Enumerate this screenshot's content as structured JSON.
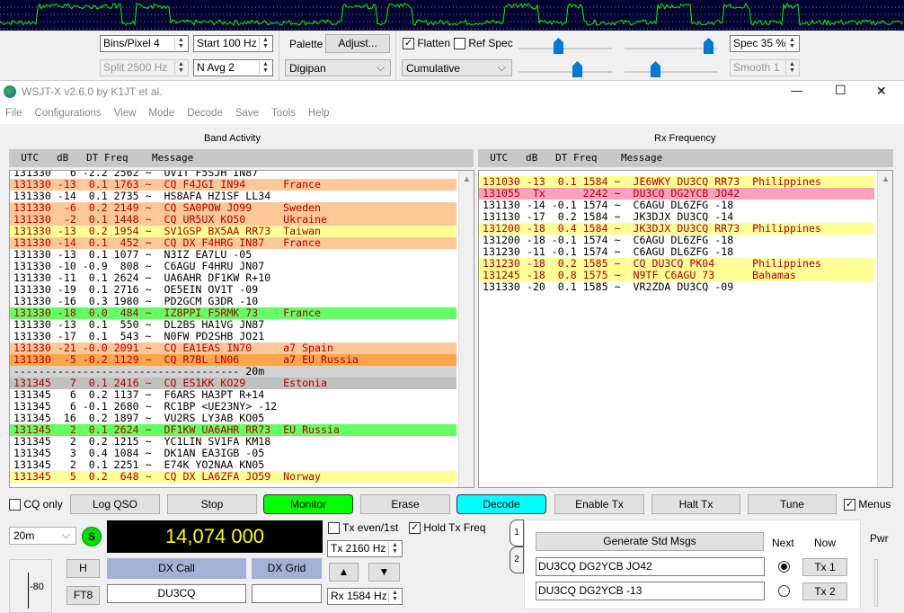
{
  "spectrum": {
    "line_color": "#00ff00",
    "bg": "#000033"
  },
  "controls": {
    "bins_pixel": "Bins/Pixel  4",
    "start": "Start 100 Hz",
    "split": "Split  2500  Hz",
    "navg": "N Avg 2",
    "palette_label": "Palette",
    "adjust": "Adjust...",
    "palette": "Digipan",
    "flatten": "Flatten",
    "flatten_checked": true,
    "refspec": "Ref Spec",
    "refspec_checked": false,
    "cumulative": "Cumulative",
    "spec": "Spec 35 %",
    "smooth": "Smooth  1"
  },
  "window": {
    "title": "WSJT-X   v2.6.0   by K1JT et al.",
    "minimize": "—",
    "maximize": "☐",
    "close": "✕"
  },
  "menu": [
    "File",
    "Configurations",
    "View",
    "Mode",
    "Decode",
    "Save",
    "Tools",
    "Help"
  ],
  "band_activity": {
    "title": "Band Activity",
    "header": "  UTC   dB   DT Freq    Message",
    "rows": [
      {
        "utc": "131330",
        "db": "6",
        "dt": "-2.2",
        "freq": "2562",
        "msg": "OV1T F5SJH IN87",
        "country": "",
        "bg": "#ffffff"
      },
      {
        "utc": "131330",
        "db": "-13",
        "dt": "0.1",
        "freq": "1763",
        "msg": "CQ F4JGI IN94",
        "country": "France",
        "bg": "#ffc896"
      },
      {
        "utc": "131330",
        "db": "-14",
        "dt": "0.1",
        "freq": "2735",
        "msg": "HS8AFA HZ1SF LL34",
        "country": "",
        "bg": "#ffffff"
      },
      {
        "utc": "131330",
        "db": "-6",
        "dt": "0.2",
        "freq": "2149",
        "msg": "CQ SA0POW JO99",
        "country": "Sweden",
        "bg": "#ffc896"
      },
      {
        "utc": "131330",
        "db": "-2",
        "dt": "0.1",
        "freq": "1448",
        "msg": "CQ UR5UX KO50",
        "country": "Ukraine",
        "bg": "#ffc896"
      },
      {
        "utc": "131330",
        "db": "-13",
        "dt": "0.2",
        "freq": "1954",
        "msg": "SV1GSP BX5AA RR73",
        "country": "Taiwan",
        "bg": "#ffff96"
      },
      {
        "utc": "131330",
        "db": "-14",
        "dt": "0.1",
        "freq": "452",
        "msg": "CQ DX F4HRG IN87",
        "country": "France",
        "bg": "#ffc896"
      },
      {
        "utc": "131330",
        "db": "-13",
        "dt": "0.1",
        "freq": "1077",
        "msg": "N3IZ EA7LU -05",
        "country": "",
        "bg": "#ffffff"
      },
      {
        "utc": "131330",
        "db": "-10",
        "dt": "-0.9",
        "freq": "808",
        "msg": "C6AGU F4HRU JN07",
        "country": "",
        "bg": "#ffffff"
      },
      {
        "utc": "131330",
        "db": "-11",
        "dt": "0.1",
        "freq": "2624",
        "msg": "UA6AHR DF1KW R+10",
        "country": "",
        "bg": "#ffffff"
      },
      {
        "utc": "131330",
        "db": "-19",
        "dt": "0.1",
        "freq": "2716",
        "msg": "OE5EIN OV1T -09",
        "country": "",
        "bg": "#ffffff"
      },
      {
        "utc": "131330",
        "db": "-16",
        "dt": "0.3",
        "freq": "1980",
        "msg": "PD2GCM G3DR -10",
        "country": "",
        "bg": "#ffffff"
      },
      {
        "utc": "131330",
        "db": "-18",
        "dt": "0.0",
        "freq": "484",
        "msg": "IZ8PPI F5RMK 73",
        "country": "France",
        "bg": "#64ff64"
      },
      {
        "utc": "131330",
        "db": "-13",
        "dt": "0.1",
        "freq": "550",
        "msg": "DL2BS HA1VG JN87",
        "country": "",
        "bg": "#ffffff"
      },
      {
        "utc": "131330",
        "db": "-17",
        "dt": "0.1",
        "freq": "543",
        "msg": "N0FW PD2SHB JO21",
        "country": "",
        "bg": "#ffffff"
      },
      {
        "utc": "131330",
        "db": "-21",
        "dt": "-0.0",
        "freq": "2091",
        "msg": "CQ EA1EAS IN70",
        "country": "a7 Spain",
        "bg": "#ffc896"
      },
      {
        "utc": "131330",
        "db": "-5",
        "dt": "-0.2",
        "freq": "1129",
        "msg": "CQ R7BL LN06",
        "country": "a7 EU Russia",
        "bg": "#ffa64d"
      },
      {
        "separator": "------------------------------------ 20m",
        "bg": "#d3d3d3"
      },
      {
        "utc": "131345",
        "db": "7",
        "dt": "0.1",
        "freq": "2416",
        "msg": "CQ ES1KK KO29",
        "country": "Estonia",
        "bg": "#c0c0c0"
      },
      {
        "utc": "131345",
        "db": "6",
        "dt": "0.2",
        "freq": "1137",
        "msg": "F6ARS HA3PT R+14",
        "country": "",
        "bg": "#ffffff"
      },
      {
        "utc": "131345",
        "db": "6",
        "dt": "-0.1",
        "freq": "2680",
        "msg": "RC1BP <UE23NY> -12",
        "country": "",
        "bg": "#ffffff"
      },
      {
        "utc": "131345",
        "db": "16",
        "dt": "0.2",
        "freq": "1897",
        "msg": "VU2RS LY3AB KO05",
        "country": "",
        "bg": "#ffffff"
      },
      {
        "utc": "131345",
        "db": "2",
        "dt": "0.1",
        "freq": "2624",
        "msg": "DF1KW UA6AHR RR73",
        "country": "EU Russia",
        "bg": "#64ff64"
      },
      {
        "utc": "131345",
        "db": "2",
        "dt": "0.2",
        "freq": "1215",
        "msg": "YC1LIN SV1FA KM18",
        "country": "",
        "bg": "#ffffff"
      },
      {
        "utc": "131345",
        "db": "3",
        "dt": "0.4",
        "freq": "1084",
        "msg": "DK1AN EA3IGB -05",
        "country": "",
        "bg": "#ffffff"
      },
      {
        "utc": "131345",
        "db": "2",
        "dt": "0.1",
        "freq": "2251",
        "msg": "E74K YO2NAA KN05",
        "country": "",
        "bg": "#ffffff"
      },
      {
        "utc": "131345",
        "db": "5",
        "dt": "0.2",
        "freq": "648",
        "msg": "CQ DX LA6ZFA JO59",
        "country": "Norway",
        "bg": "#ffff96"
      }
    ]
  },
  "rx_frequency": {
    "title": "Rx Frequency",
    "header": "  UTC   dB   DT Freq    Message",
    "rows": [
      {
        "utc": "131030",
        "db": "-13",
        "dt": "0.1",
        "freq": "1584",
        "msg": "JE6WKY DU3CQ RR73",
        "country": "Philippines",
        "bg": "#ffff96"
      },
      {
        "utc": "131055",
        "db": "Tx",
        "dt": "",
        "freq": "2242",
        "msg": "DU3CQ DG2YCB JO42",
        "country": "",
        "bg": "#ffa0c0"
      },
      {
        "utc": "131130",
        "db": "-14",
        "dt": "-0.1",
        "freq": "1574",
        "msg": "C6AGU DL6ZFG -18",
        "country": "",
        "bg": "#ffffff"
      },
      {
        "utc": "131130",
        "db": "-17",
        "dt": "0.2",
        "freq": "1584",
        "msg": "JK3DJX DU3CQ -14",
        "country": "",
        "bg": "#ffffff"
      },
      {
        "utc": "131200",
        "db": "-18",
        "dt": "0.4",
        "freq": "1584",
        "msg": "JK3DJX DU3CQ RR73",
        "country": "Philippines",
        "bg": "#ffff96"
      },
      {
        "utc": "131200",
        "db": "-18",
        "dt": "-0.1",
        "freq": "1574",
        "msg": "C6AGU DL6ZFG -18",
        "country": "",
        "bg": "#ffffff"
      },
      {
        "utc": "131230",
        "db": "-11",
        "dt": "-0.1",
        "freq": "1574",
        "msg": "C6AGU DL6ZFG -18",
        "country": "",
        "bg": "#ffffff"
      },
      {
        "utc": "131230",
        "db": "-18",
        "dt": "0.2",
        "freq": "1585",
        "msg": "CQ DU3CQ PK04",
        "country": "Philippines",
        "bg": "#ffff96"
      },
      {
        "utc": "131245",
        "db": "-18",
        "dt": "0.8",
        "freq": "1575",
        "msg": "N9TF C6AGU 73",
        "country": "Bahamas",
        "bg": "#ffff96"
      },
      {
        "utc": "131330",
        "db": "-20",
        "dt": "0.1",
        "freq": "1585",
        "msg": "VR2ZDA DU3CQ -09",
        "country": "",
        "bg": "#ffffff"
      }
    ]
  },
  "buttons": {
    "cq_only": "CQ only",
    "log_qso": "Log QSO",
    "stop": "Stop",
    "monitor": "Monitor",
    "erase": "Erase",
    "decode": "Decode",
    "enable_tx": "Enable Tx",
    "halt_tx": "Halt Tx",
    "tune": "Tune",
    "menus": "Menus",
    "menus_checked": true,
    "monitor_color": "#00ff00",
    "decode_color": "#00ffff"
  },
  "station": {
    "band": "20m",
    "s_label": "S",
    "frequency": "14,074 000",
    "tx_even": "Tx even/1st",
    "hold_tx": "Hold Tx Freq",
    "tx_freq": "Tx  2160  Hz",
    "rx_freq": "Rx  1584  Hz",
    "up": "▲",
    "down": "▼",
    "h": "H",
    "ft8": "FT8",
    "dx_call_label": "DX Call",
    "dx_grid_label": "DX Grid",
    "dx_call": "DU3CQ",
    "dx_grid": "",
    "meter_tick": "-80",
    "pwr": "Pwr"
  },
  "tx_panel": {
    "tab1": "1",
    "tab2": "2",
    "generate": "Generate Std Msgs",
    "next": "Next",
    "now": "Now",
    "msgs": [
      {
        "text": "DU3CQ DG2YCB JO42",
        "btn": "Tx 1",
        "selected": true
      },
      {
        "text": "DU3CQ DG2YCB -13",
        "btn": "Tx 2",
        "selected": false
      }
    ]
  }
}
